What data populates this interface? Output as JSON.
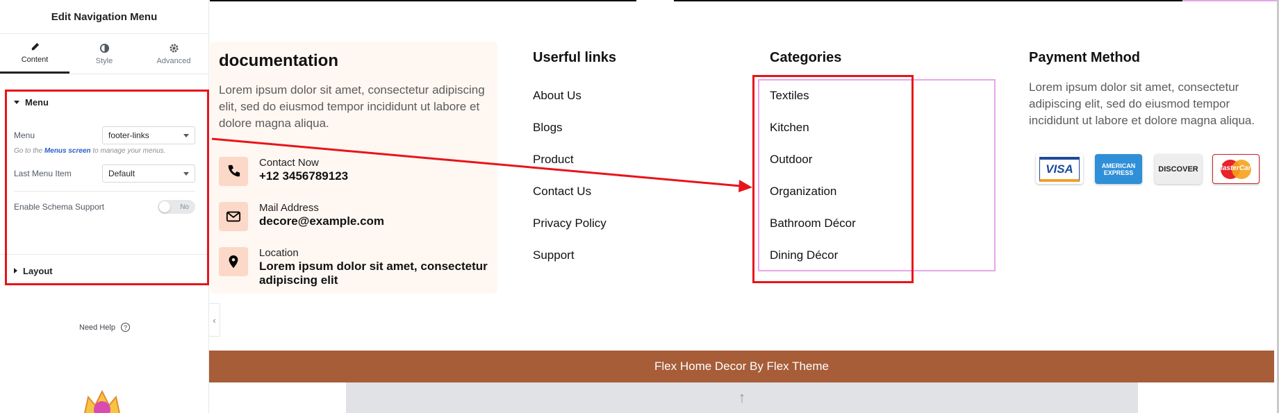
{
  "panel": {
    "title": "Edit Navigation Menu",
    "tabs": [
      {
        "label": "Content",
        "icon": "pencil-icon"
      },
      {
        "label": "Style",
        "icon": "contrast-icon"
      },
      {
        "label": "Advanced",
        "icon": "gear-icon"
      }
    ],
    "menu_section": {
      "title": "Menu",
      "menu_label": "Menu",
      "menu_value": "footer-links",
      "hint_prefix": "Go to the",
      "hint_link": "Menus screen",
      "hint_suffix": "to manage your menus.",
      "last_item_label": "Last Menu Item",
      "last_item_value": "Default",
      "schema_label": "Enable Schema Support",
      "schema_toggle": "No"
    },
    "layout_section": {
      "title": "Layout"
    },
    "help": {
      "label": "Need Help",
      "icon": "question-icon"
    }
  },
  "page": {
    "documentation": {
      "title": "documentation",
      "text": "Lorem ipsum dolor sit amet, consectetur adipiscing elit, sed do eiusmod tempor incididunt ut labore et dolore magna aliqua.",
      "contacts": [
        {
          "icon": "phone-icon",
          "label": "Contact Now",
          "value": "+12 3456789123"
        },
        {
          "icon": "mail-icon",
          "label": "Mail Address",
          "value": "decore@example.com"
        },
        {
          "icon": "location-icon",
          "label": "Location",
          "value": "Lorem ipsum dolor sit amet, consectetur adipiscing elit"
        }
      ]
    },
    "useful_links": {
      "title": "Userful links",
      "items": [
        "About Us",
        "Blogs",
        "Product",
        "Contact Us",
        "Privacy Policy",
        "Support"
      ]
    },
    "categories": {
      "title": "Categories",
      "items": [
        "Textiles",
        "Kitchen",
        "Outdoor",
        "Organization",
        "Bathroom Décor",
        "Dining Décor"
      ]
    },
    "payment": {
      "title": "Payment Method",
      "text": "Lorem ipsum dolor sit amet, consectetur adipiscing elit, sed do eiusmod tempor incididunt ut labore et dolore magna aliqua.",
      "cards": [
        "VISA",
        "AMERICAN EXPRESS",
        "DISCOVER",
        "MasterCard"
      ]
    },
    "footer": {
      "text": "Flex Home Decor  By  Flex Theme"
    }
  },
  "colors": {
    "highlight": "#e8141a",
    "footer_bg": "#a65d38",
    "selection": "#e7a6e7"
  }
}
